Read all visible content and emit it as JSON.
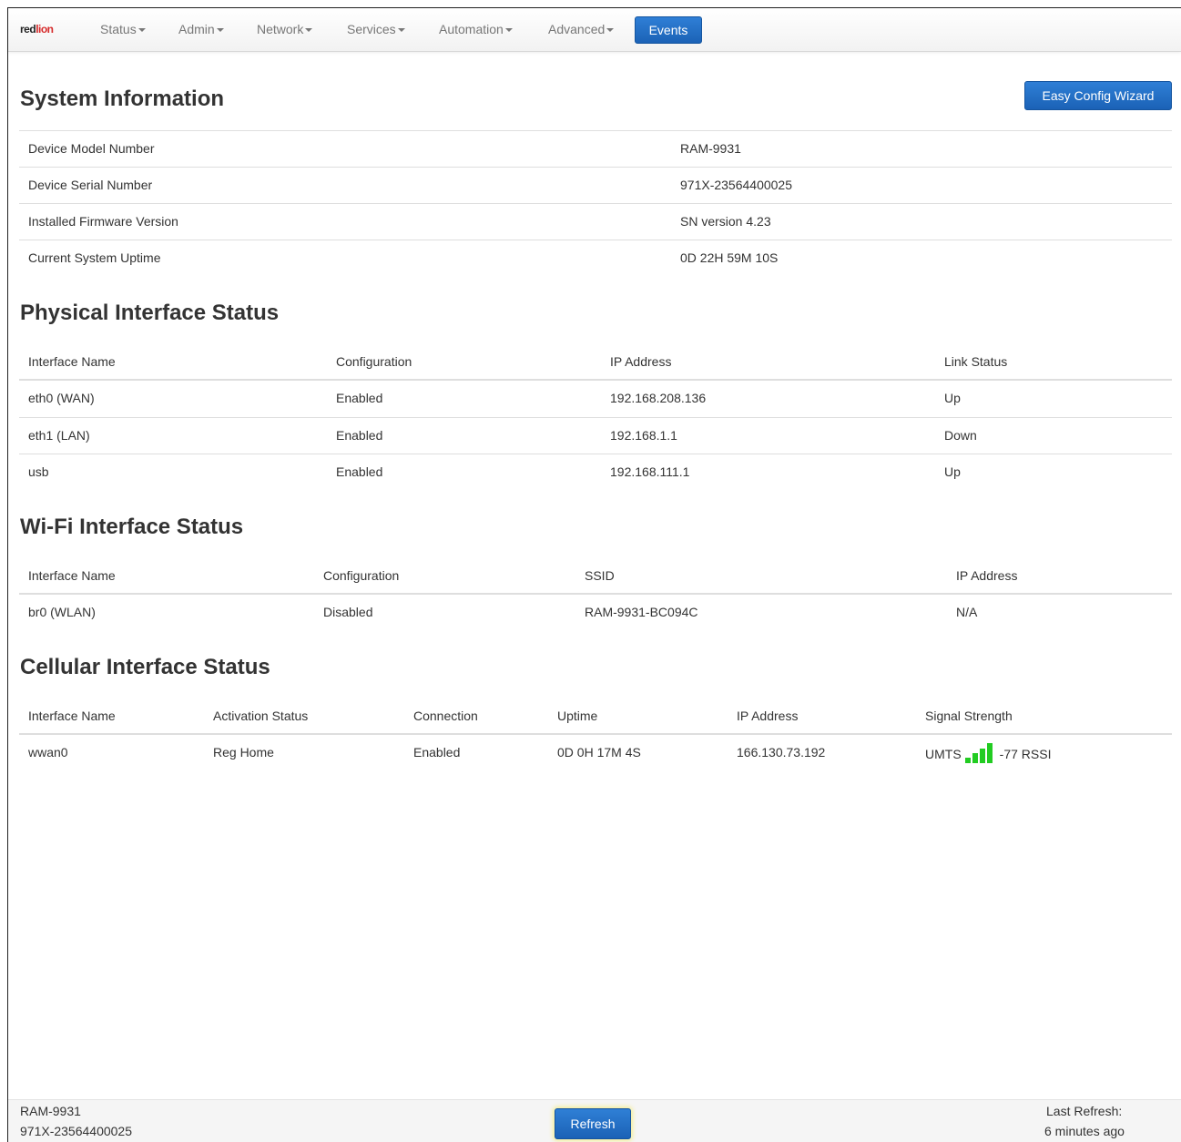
{
  "brand": {
    "name_part1": "red",
    "name_part2": "lion"
  },
  "nav": {
    "items": [
      "Status",
      "Admin",
      "Network",
      "Services",
      "Automation",
      "Advanced"
    ],
    "active": "Events"
  },
  "system_info": {
    "title": "System Information",
    "wizard_button": "Easy Config Wizard",
    "rows": [
      {
        "label": "Device Model Number",
        "value": "RAM-9931"
      },
      {
        "label": "Device Serial Number",
        "value": "971X-23564400025"
      },
      {
        "label": "Installed Firmware Version",
        "value": "SN version 4.23"
      },
      {
        "label": "Current System Uptime",
        "value": "0D 22H 59M 10S"
      }
    ]
  },
  "physical": {
    "title": "Physical Interface Status",
    "headers": [
      "Interface Name",
      "Configuration",
      "IP Address",
      "Link Status"
    ],
    "rows": [
      [
        "eth0 (WAN)",
        "Enabled",
        "192.168.208.136",
        "Up"
      ],
      [
        "eth1 (LAN)",
        "Enabled",
        "192.168.1.1",
        "Down"
      ],
      [
        "usb",
        "Enabled",
        "192.168.111.1",
        "Up"
      ]
    ]
  },
  "wifi": {
    "title": "Wi-Fi Interface Status",
    "headers": [
      "Interface Name",
      "Configuration",
      "SSID",
      "IP Address"
    ],
    "rows": [
      [
        "br0 (WLAN)",
        "Disabled",
        "RAM-9931-BC094C",
        "N/A"
      ]
    ]
  },
  "cellular": {
    "title": "Cellular Interface Status",
    "headers": [
      "Interface Name",
      "Activation Status",
      "Connection",
      "Uptime",
      "IP Address",
      "Signal Strength"
    ],
    "rows": [
      [
        "wwan0",
        "Reg Home",
        "Enabled",
        "0D 0H 17M 4S",
        "166.130.73.192"
      ]
    ],
    "signal": {
      "tech": "UMTS",
      "rssi": "-77 RSSI",
      "bars_lit": 4,
      "bars_total": 4,
      "bar_color": "#22cc22"
    }
  },
  "footer": {
    "model": "RAM-9931",
    "serial": "971X-23564400025",
    "refresh_button": "Refresh",
    "last_refresh_label": "Last Refresh:",
    "last_refresh_value": "6 minutes ago"
  },
  "colors": {
    "accent": "#1f6cc4",
    "signal": "#22cc22",
    "brand_red": "#d62a2a"
  }
}
